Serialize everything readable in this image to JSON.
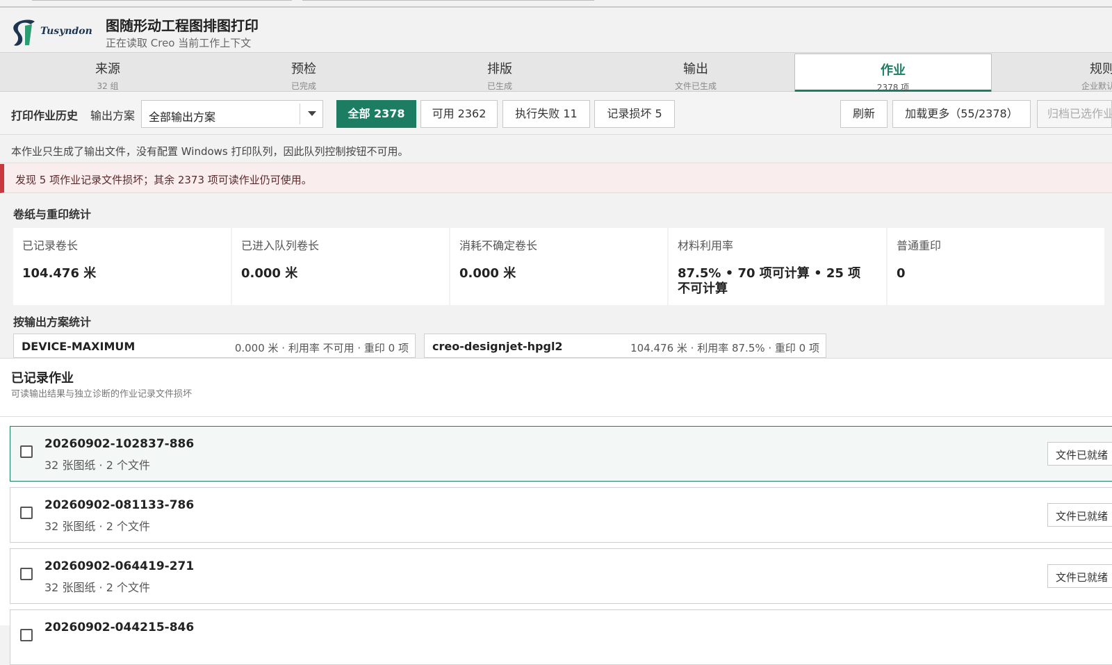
{
  "app": {
    "brand": "Tusyndon",
    "title": "图随形动工程图排图打印",
    "subtitle": "正在读取 Creo 当前工作上下文"
  },
  "tabs": [
    {
      "label": "来源",
      "sub": "32 组"
    },
    {
      "label": "预检",
      "sub": "已完成"
    },
    {
      "label": "排版",
      "sub": "已生成"
    },
    {
      "label": "输出",
      "sub": "文件已生成"
    },
    {
      "label": "作业",
      "sub": "2378 项",
      "active": true
    },
    {
      "label": "规则",
      "sub": "企业默认"
    }
  ],
  "toolbar": {
    "history_label": "打印作业历史",
    "plan_label": "输出方案",
    "plan_value": "全部输出方案",
    "filter_all": "全部 2378",
    "filter_available": "可用 2362",
    "filter_failed": "执行失败 11",
    "filter_corrupt": "记录损坏 5",
    "refresh": "刷新",
    "load_more": "加载更多（55/2378）",
    "archive": "归档已选作业"
  },
  "notice": "本作业只生成了输出文件，没有配置 Windows 打印队列，因此队列控制按钮不可用。",
  "alert": "发现 5 项作业记录文件损坏；其余 2373 项可读作业仍可使用。",
  "stats": {
    "title": "卷纸与重印统计",
    "items": [
      {
        "label": "已记录卷长",
        "value": "104.476 米"
      },
      {
        "label": "已进入队列卷长",
        "value": "0.000 米"
      },
      {
        "label": "消耗不确定卷长",
        "value": "0.000 米"
      },
      {
        "label": "材料利用率",
        "value": "87.5% • 70 项可计算 • 25 项不可计算"
      },
      {
        "label": "普通重印",
        "value": "0"
      }
    ]
  },
  "by_plan": {
    "title": "按输出方案统计",
    "plans": [
      {
        "name": "DEVICE-MAXIMUM",
        "detail": "0.000 米 · 利用率 不可用 · 重印 0 项"
      },
      {
        "name": "creo-designjet-hpgl2",
        "detail": "104.476 米 · 利用率 87.5% · 重印 0 项"
      }
    ]
  },
  "jobs": {
    "title": "已记录作业",
    "subtitle": "可读输出结果与独立诊断的作业记录文件损坏",
    "items": [
      {
        "id": "20260902-102837-886",
        "meta": "32 张图纸 · 2 个文件",
        "status": "文件已就绪"
      },
      {
        "id": "20260902-081133-786",
        "meta": "32 张图纸 · 2 个文件",
        "status": "文件已就绪"
      },
      {
        "id": "20260902-064419-271",
        "meta": "32 张图纸 · 2 个文件",
        "status": "文件已就绪"
      },
      {
        "id": "20260902-044215-846",
        "meta": "",
        "status": ""
      }
    ]
  },
  "colors": {
    "accent": "#1c7d63",
    "alert": "#c9373f"
  }
}
